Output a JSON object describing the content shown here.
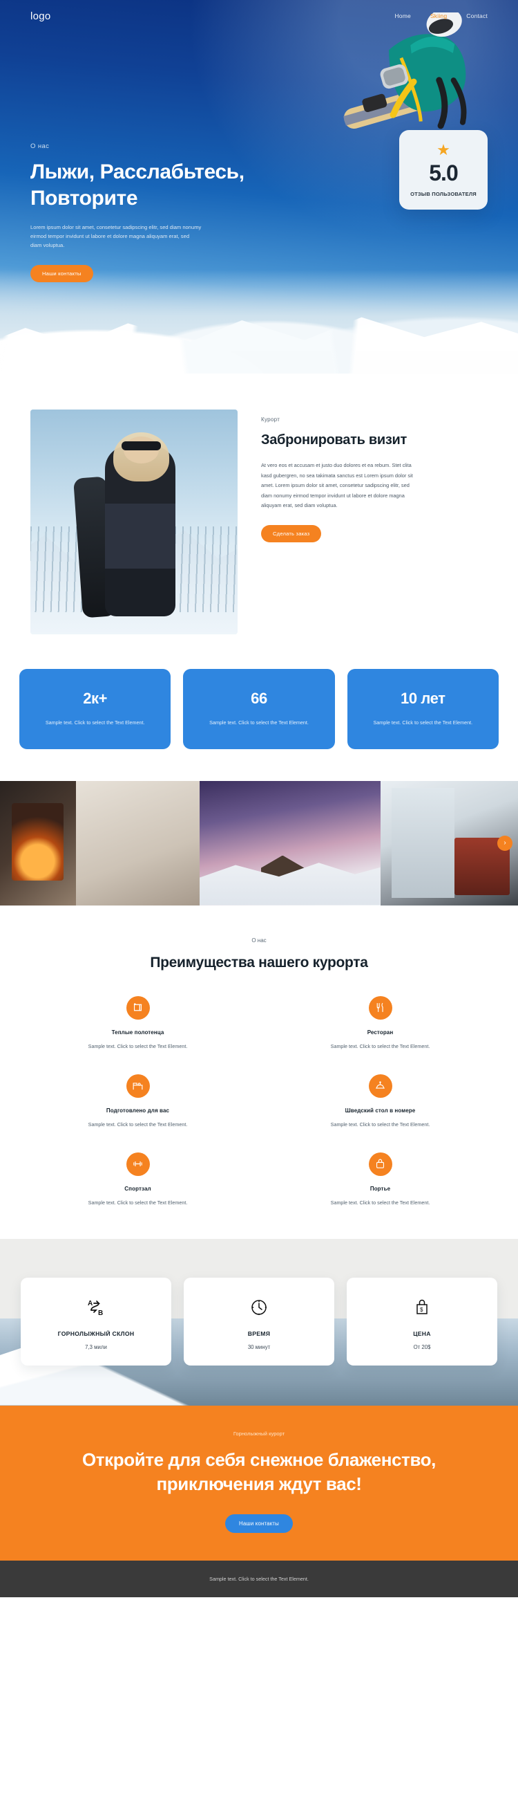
{
  "nav": {
    "logo": "logo",
    "links": [
      {
        "label": "Home",
        "active": false
      },
      {
        "label": "Skiing",
        "active": true
      },
      {
        "label": "Contact",
        "active": false
      }
    ]
  },
  "hero": {
    "eyebrow": "О нас",
    "title": "Лыжи, Расслабьтесь, Повторите",
    "copy": "Lorem ipsum dolor sit amet, consetetur sadipscing elitr, sed diam nonumy eirmod tempor invidunt ut labore et dolore magna aliquyam erat, sed diam voluptua.",
    "button": "Наши контакты",
    "rating": {
      "star_icon": "star-icon",
      "value": "5.0",
      "label": "ОТЗЫВ ПОЛЬЗОВАТЕЛЯ"
    }
  },
  "booking": {
    "eyebrow": "Курорт",
    "title": "Забронировать визит",
    "copy": "At vero eos et accusam et justo duo dolores et ea rebum. Stet clita kasd gubergren, no sea takimata sanctus est Lorem ipsum dolor sit amet. Lorem ipsum dolor sit amet, consetetur sadipscing elitr, sed diam nonumy eirmod tempor invidunt ut labore et dolore magna aliquyam erat, sed diam voluptua.",
    "button": "Сделать заказ"
  },
  "stats": [
    {
      "number": "2к+",
      "text": "Sample text. Click to select the Text Element."
    },
    {
      "number": "66",
      "text": "Sample text. Click to select the Text Element."
    },
    {
      "number": "10 лет",
      "text": "Sample text. Click to select the Text Element."
    }
  ],
  "gallery": {
    "next_icon": "chevron-right-icon",
    "slides": [
      "fireplace-living-room",
      "winter-lake-sofa",
      "snow-village-dusk",
      "cabin-interior-window"
    ]
  },
  "amenities": {
    "eyebrow": "О нас",
    "title": "Преимущества нашего курорта",
    "items": [
      {
        "icon": "towel-icon",
        "name": "Теплые полотенца",
        "text": "Sample text. Click to select the Text Element."
      },
      {
        "icon": "restaurant-icon",
        "name": "Ресторан",
        "text": "Sample text. Click to select the Text Element."
      },
      {
        "icon": "bed-prepared-icon",
        "name": "Подготовлено для вас",
        "text": "Sample text. Click to select the Text Element."
      },
      {
        "icon": "room-service-icon",
        "name": "Шведский стол в номере",
        "text": "Sample text. Click to select the Text Element."
      },
      {
        "icon": "gym-icon",
        "name": "Спортзал",
        "text": "Sample text. Click to select the Text Element."
      },
      {
        "icon": "porter-icon",
        "name": "Портье",
        "text": "Sample text. Click to select the Text Element."
      }
    ]
  },
  "info_cards": [
    {
      "icon": "route-a-to-b-icon",
      "name": "ГОРНОЛЫЖНЫЙ СКЛОН",
      "value": "7,3 мили"
    },
    {
      "icon": "clock-icon",
      "name": "ВРЕМЯ",
      "value": "30 минут"
    },
    {
      "icon": "price-tag-icon",
      "name": "ЦЕНА",
      "value": "От 20$"
    }
  ],
  "cta": {
    "eyebrow": "Горнолыжный курорт",
    "title": "Откройте для себя снежное блаженство, приключения ждут вас!",
    "button": "Наши контакты"
  },
  "footer": {
    "text": "Sample text. Click to select the Text Element."
  },
  "colors": {
    "orange": "#f58220",
    "blue": "#2f86e0",
    "hero_blue": "#104195",
    "star": "#f5a623"
  }
}
